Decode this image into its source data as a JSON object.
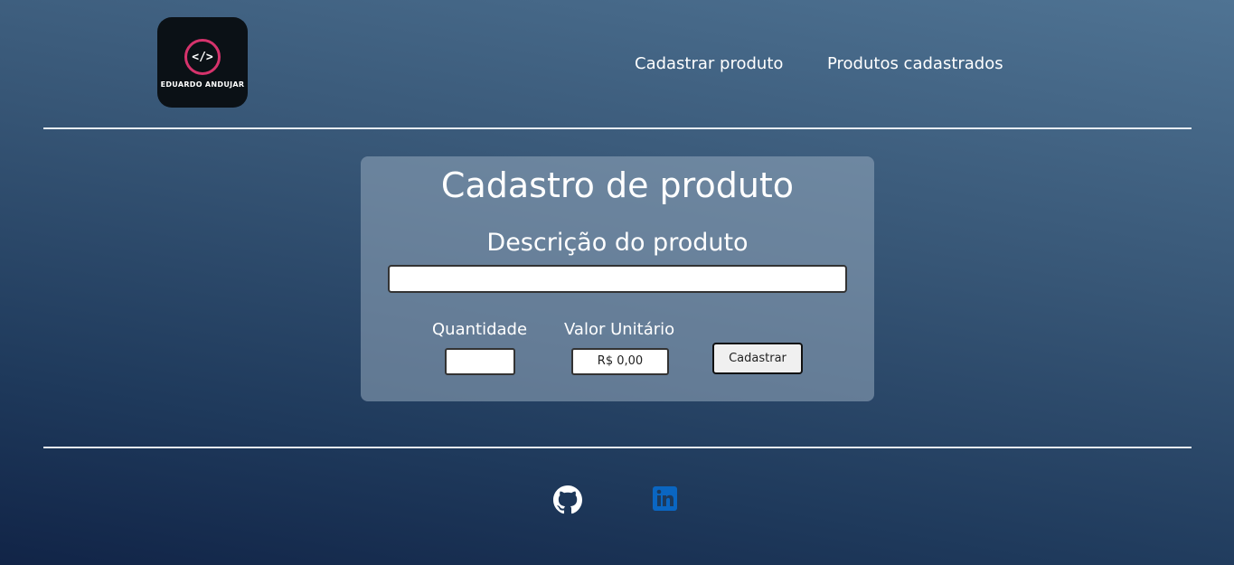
{
  "header": {
    "logo": {
      "symbol": "</>",
      "name": "EDUARDO ANDUJAR",
      "icon": "code-icon",
      "accent": "#d6336c"
    },
    "nav": [
      {
        "label": "Cadastrar produto"
      },
      {
        "label": "Produtos cadastrados"
      }
    ]
  },
  "form": {
    "title": "Cadastro de produto",
    "description_label": "Descrição do produto",
    "description_value": "",
    "quantity_label": "Quantidade",
    "quantity_value": "",
    "unit_price_label": "Valor Unitário",
    "unit_price_value": "R$ 0,00",
    "submit_label": "Cadastrar"
  },
  "footer": {
    "links": [
      {
        "icon": "github-icon"
      },
      {
        "icon": "linkedin-icon",
        "color": "#0a66c2"
      }
    ]
  }
}
